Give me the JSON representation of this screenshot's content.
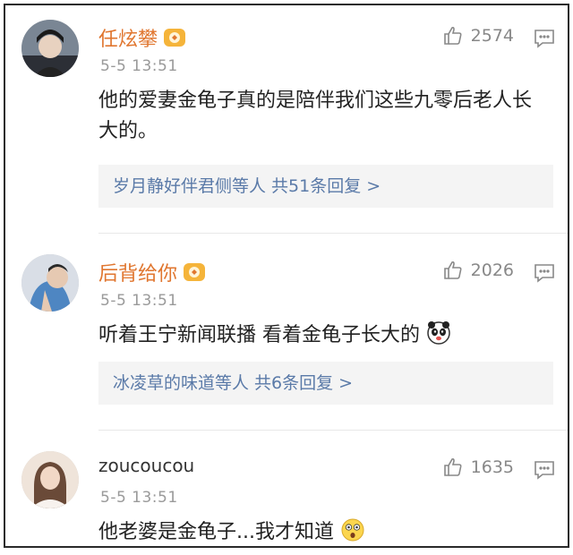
{
  "comments": [
    {
      "user": "任炫攀",
      "time": "5-5 13:51",
      "likes": "2574",
      "text": "他的爱妻金龟子真的是陪伴我们这些九零后老人长大的。",
      "replies": "岁月静好伴君侧等人 共51条回复 >",
      "vip": true
    },
    {
      "user": "后背给你",
      "time": "5-5 13:51",
      "likes": "2026",
      "text": "听着王宁新闻联播  看着金龟子长大的",
      "replies": "冰凌草的味道等人 共6条回复 >",
      "vip": true,
      "emoji": "panda-emoji"
    },
    {
      "user": "zoucoucou",
      "time": "5-5 13:51",
      "likes": "1635",
      "text": "他老婆是金龟子...我才知道",
      "vip": false,
      "emoji": "shocked-emoji"
    }
  ],
  "colors": {
    "username": "#e0762f",
    "reply_link": "#5a7aa8",
    "meta": "#9a9a9a"
  }
}
